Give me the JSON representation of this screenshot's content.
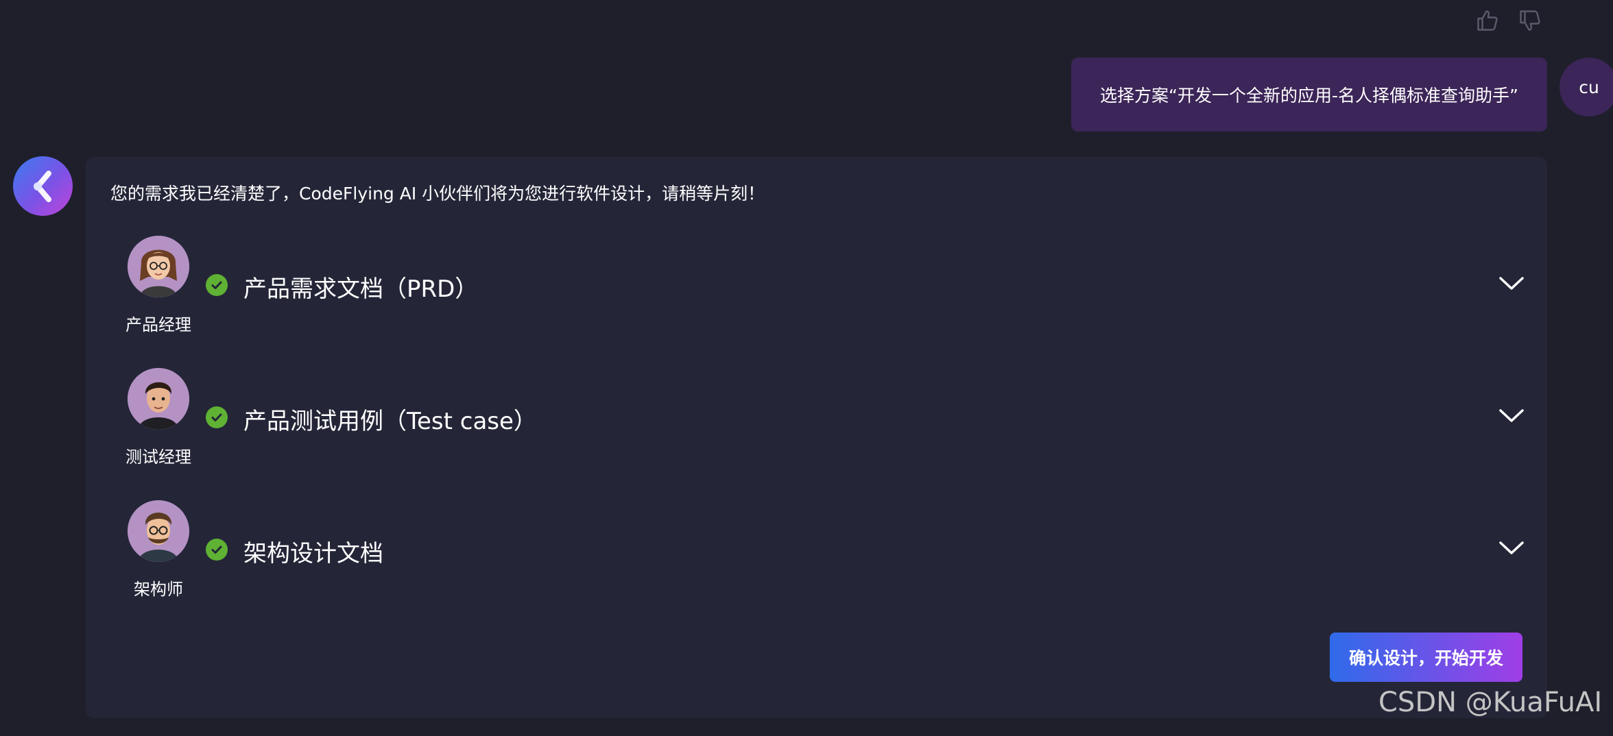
{
  "feedback": {
    "like_icon": "thumbs-up-icon",
    "dislike_icon": "thumbs-down-icon"
  },
  "user_message": {
    "text": "选择方案“开发一个全新的应用-名人择偶标准查询助手”",
    "avatar_initials": "cu"
  },
  "assistant": {
    "avatar_icon": "codeflying-logo-icon",
    "intro": "您的需求我已经清楚了，CodeFlying AI 小伙伴们将为您进行软件设计，请稍等片刻！",
    "items": [
      {
        "role": "产品经理",
        "title": "产品需求文档（PRD）",
        "status": "completed"
      },
      {
        "role": "测试经理",
        "title": "产品测试用例（Test case）",
        "status": "completed"
      },
      {
        "role": "架构师",
        "title": "架构设计文档",
        "status": "completed"
      }
    ],
    "confirm_button": "确认设计，开始开发"
  },
  "watermark": "CSDN @KuaFuAI",
  "colors": {
    "background": "#1e1f2b",
    "card": "#242638",
    "user_bubble": "#3c2558",
    "check": "#5fb233",
    "button_gradient_start": "#2f6bea",
    "button_gradient_end": "#a03ee6"
  }
}
